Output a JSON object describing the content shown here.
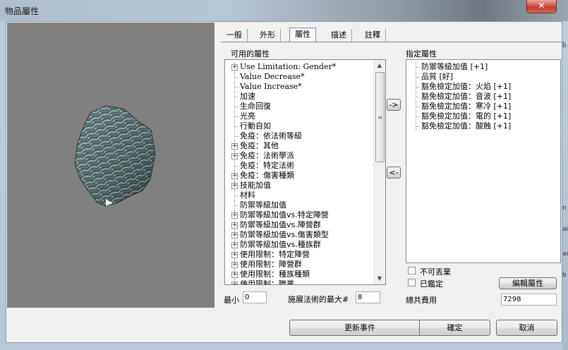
{
  "window": {
    "title": "物品屬性",
    "close_glyph": "✕"
  },
  "tabs": [
    {
      "label": "一般"
    },
    {
      "label": "外形"
    },
    {
      "label": "屬性"
    },
    {
      "label": "描述"
    },
    {
      "label": "註釋"
    }
  ],
  "available": {
    "header": "可用的屬性",
    "items": [
      {
        "label": "Use Limitation: Gender*",
        "expand": true
      },
      {
        "label": "Value Decrease*",
        "expand": false
      },
      {
        "label": "Value Increase*",
        "expand": false
      },
      {
        "label": "加速",
        "expand": false
      },
      {
        "label": "生命回復",
        "expand": false
      },
      {
        "label": "光亮",
        "expand": false
      },
      {
        "label": "行動自如",
        "expand": false
      },
      {
        "label": "免疫：依法術等級",
        "expand": false
      },
      {
        "label": "免疫：其他",
        "expand": true
      },
      {
        "label": "免疫：法術學派",
        "expand": true
      },
      {
        "label": "免疫：特定法術",
        "expand": false
      },
      {
        "label": "免疫：傷害種類",
        "expand": true
      },
      {
        "label": "技能加值",
        "expand": true
      },
      {
        "label": "材料",
        "expand": false
      },
      {
        "label": "防禦等級加值",
        "expand": false
      },
      {
        "label": "防禦等級加值vs.特定陣營",
        "expand": true
      },
      {
        "label": "防禦等級加值vs.陣營群",
        "expand": true
      },
      {
        "label": "防禦等級加值vs.傷害類型",
        "expand": true
      },
      {
        "label": "防禦等級加值vs.種族群",
        "expand": true
      },
      {
        "label": "使用限制：特定陣營",
        "expand": true
      },
      {
        "label": "使用限制：陣營群",
        "expand": true
      },
      {
        "label": "使用限制：種族種類",
        "expand": true
      },
      {
        "label": "使用限制：職業",
        "expand": true
      }
    ]
  },
  "assigned": {
    "header": "指定屬性",
    "items": [
      {
        "label": "防禦等級加值 [+1]"
      },
      {
        "label": "品質 [好]"
      },
      {
        "label": "豁免檢定加值：火焰 [+1]"
      },
      {
        "label": "豁免檢定加值：音波 [+1]"
      },
      {
        "label": "豁免檢定加值：寒冷 [+1]"
      },
      {
        "label": "豁免檢定加值：電的 [+1]"
      },
      {
        "label": "豁免檢定加值：酸蝕 [+1]"
      }
    ]
  },
  "buttons": {
    "add": "->",
    "remove": "<-",
    "edit_properties": "編輯屬性",
    "update_event": "更新事件",
    "ok": "確定",
    "cancel": "取消"
  },
  "checkboxes": {
    "undroppable": "不可丟棄",
    "identified": "已鑑定"
  },
  "fields": {
    "min_label": "最小",
    "min_value": "0",
    "max_spell_label": "施展法術的最大#",
    "max_spell_value": "8",
    "total_cost_label": "總共費用",
    "total_cost_value": "7298"
  },
  "preview": {
    "description": "3D item model preview"
  }
}
